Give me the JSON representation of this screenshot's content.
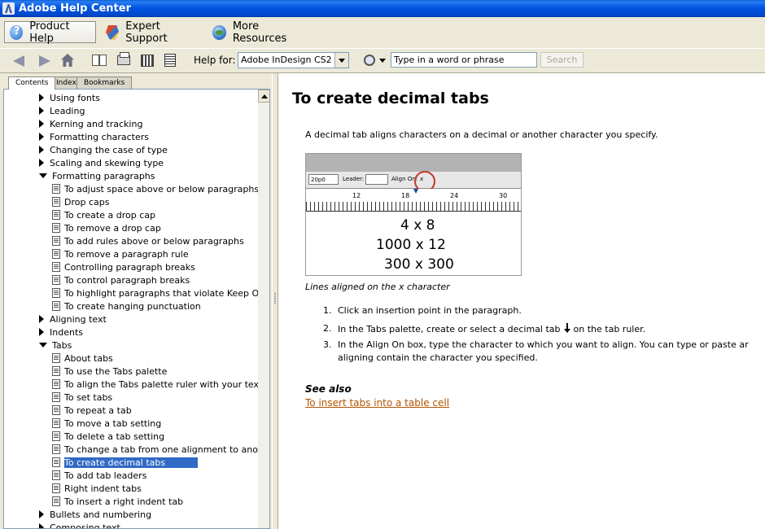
{
  "window": {
    "title": "Adobe Help Center"
  },
  "top_tabs": [
    {
      "label": "Product Help"
    },
    {
      "label": "Expert Support"
    },
    {
      "label": "More Resources"
    }
  ],
  "toolbar": {
    "help_for_label": "Help for:",
    "product_select": "Adobe InDesign CS2",
    "search_placeholder": "Type in a word or phrase",
    "search_button": "Search"
  },
  "left_tabs": [
    "Contents",
    "Index",
    "Bookmarks"
  ],
  "tree": [
    {
      "label": "Using fonts",
      "type": "collapsed"
    },
    {
      "label": "Leading",
      "type": "collapsed"
    },
    {
      "label": "Kerning and tracking",
      "type": "collapsed"
    },
    {
      "label": "Formatting characters",
      "type": "collapsed"
    },
    {
      "label": "Changing the case of type",
      "type": "collapsed"
    },
    {
      "label": "Scaling and skewing type",
      "type": "collapsed"
    },
    {
      "label": "Formatting paragraphs",
      "type": "expanded"
    },
    {
      "label": "To adjust space above or below paragraphs",
      "type": "doc"
    },
    {
      "label": "Drop caps",
      "type": "doc"
    },
    {
      "label": "To create a drop cap",
      "type": "doc"
    },
    {
      "label": "To remove a drop cap",
      "type": "doc"
    },
    {
      "label": "To add rules above or below paragraphs",
      "type": "doc"
    },
    {
      "label": "To remove a paragraph rule",
      "type": "doc"
    },
    {
      "label": "Controlling paragraph breaks",
      "type": "doc"
    },
    {
      "label": "To control paragraph breaks",
      "type": "doc"
    },
    {
      "label": "To highlight paragraphs that violate Keep Options",
      "type": "doc"
    },
    {
      "label": "To create hanging punctuation",
      "type": "doc"
    },
    {
      "label": "Aligning text",
      "type": "collapsed"
    },
    {
      "label": "Indents",
      "type": "collapsed"
    },
    {
      "label": "Tabs",
      "type": "expanded"
    },
    {
      "label": "About tabs",
      "type": "doc"
    },
    {
      "label": "To use the Tabs palette",
      "type": "doc"
    },
    {
      "label": "To align the Tabs palette ruler with your text",
      "type": "doc"
    },
    {
      "label": "To set tabs",
      "type": "doc"
    },
    {
      "label": "To repeat a tab",
      "type": "doc"
    },
    {
      "label": "To move a tab setting",
      "type": "doc"
    },
    {
      "label": "To delete a tab setting",
      "type": "doc"
    },
    {
      "label": "To change a tab from one alignment to another",
      "type": "doc"
    },
    {
      "label": "To create decimal tabs",
      "type": "doc",
      "selected": true
    },
    {
      "label": "To add tab leaders",
      "type": "doc"
    },
    {
      "label": "Right indent tabs",
      "type": "doc"
    },
    {
      "label": "To insert a right indent tab",
      "type": "doc"
    },
    {
      "label": "Bullets and numbering",
      "type": "collapsed"
    },
    {
      "label": "Composing text",
      "type": "collapsed"
    }
  ],
  "article": {
    "title": "To create decimal tabs",
    "intro": "A decimal tab aligns characters on a decimal or another character you specify.",
    "figure": {
      "field_value": "20p0",
      "leader_label": "Leader:",
      "align_on_label": "Align On:",
      "align_on_value": "x",
      "ruler_numbers": [
        "12",
        "18",
        "24",
        "30"
      ],
      "lines": [
        "4 x 8",
        "1000 x 12",
        "300 x 300"
      ]
    },
    "caption": "Lines aligned on the x character",
    "steps": [
      {
        "num": "1.",
        "text": "Click an insertion point in the paragraph."
      },
      {
        "num": "2.",
        "text_before": "In the Tabs palette, create or select a decimal tab",
        "text_after": "on the tab ruler."
      },
      {
        "num": "3.",
        "line1": "In the Align On box, type the character to which you want to align. You can type or paste ar",
        "line2": "aligning contain the character you specified."
      }
    ],
    "see_also_label": "See also",
    "see_also_link": "To insert tabs into a table cell"
  },
  "colors": {
    "selection": "#316ac5",
    "link": "#b35400",
    "titlebar": "#0054e3"
  }
}
